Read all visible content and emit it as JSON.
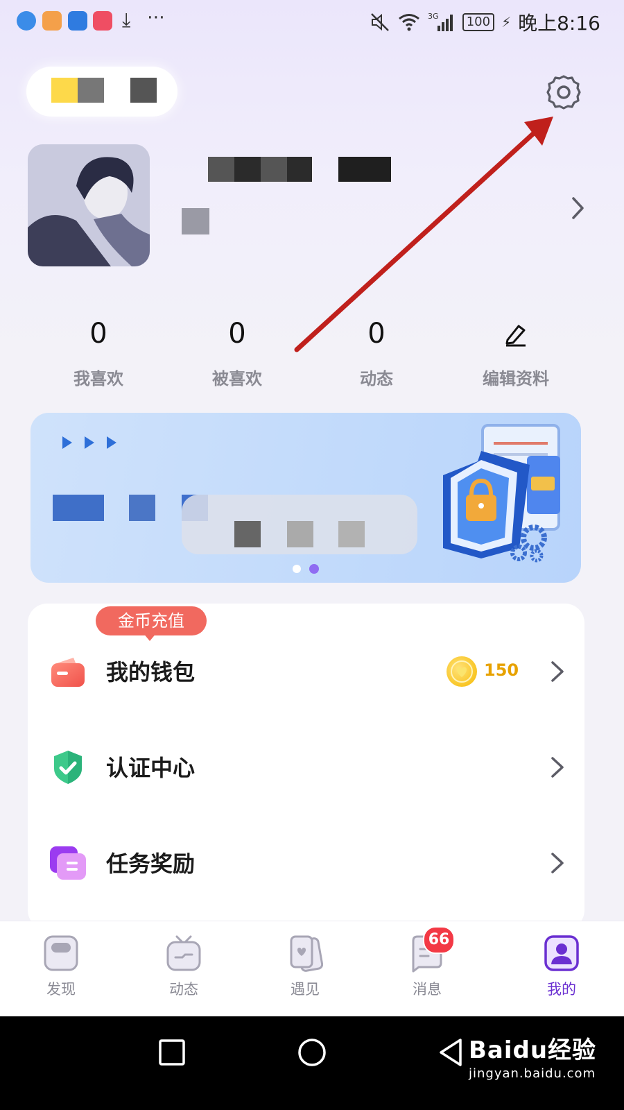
{
  "status_bar": {
    "time": "晚上8:16",
    "battery": "100",
    "network": "3G"
  },
  "profile": {
    "following_count": "0",
    "following_label": "我喜欢",
    "followers_count": "0",
    "followers_label": "被喜欢",
    "posts_count": "0",
    "posts_label": "动态",
    "edit_label": "编辑资料"
  },
  "menu": {
    "recharge_badge": "金币充值",
    "items": [
      {
        "label": "我的钱包",
        "icon": "wallet-icon",
        "coins": "150"
      },
      {
        "label": "认证中心",
        "icon": "shield-check-icon"
      },
      {
        "label": "任务奖励",
        "icon": "task-icon"
      }
    ]
  },
  "tabbar": {
    "items": [
      {
        "label": "发现",
        "icon": "discover-icon"
      },
      {
        "label": "动态",
        "icon": "tv-icon"
      },
      {
        "label": "遇见",
        "icon": "cards-icon"
      },
      {
        "label": "消息",
        "icon": "message-icon",
        "badge": "66"
      },
      {
        "label": "我的",
        "icon": "profile-icon",
        "active": true
      }
    ]
  },
  "watermark": {
    "brand": "Baidu经验",
    "url": "jingyan.baidu.com"
  },
  "colors": {
    "accent": "#6a2fd1",
    "badge_red": "#f33945",
    "annotation_arrow": "#c0201c",
    "coin": "#f6b900"
  }
}
